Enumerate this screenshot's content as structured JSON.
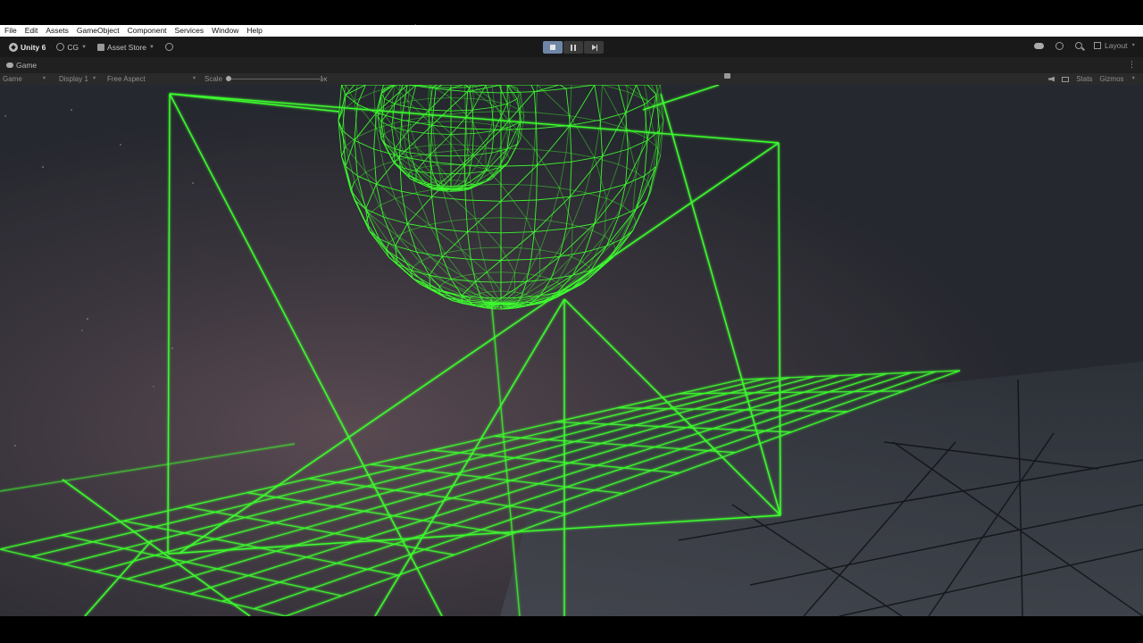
{
  "menubar": {
    "items": [
      "File",
      "Edit",
      "Assets",
      "GameObject",
      "Component",
      "Services",
      "Window",
      "Help"
    ]
  },
  "toolbar": {
    "unity_label": "Unity 6",
    "account_label": "CG",
    "asset_store_label": "Asset Store",
    "layout_label": "Layout",
    "play_state": "playing"
  },
  "tab": {
    "label": "Game"
  },
  "game_toolbar": {
    "mode_label": "Game",
    "display_label": "Display 1",
    "aspect_label": "Free Aspect",
    "scale_label": "Scale",
    "scale_value": "1x",
    "stats_label": "Stats",
    "gizmos_label": "Gizmos"
  },
  "colors": {
    "wireframe": "#3dff2e",
    "toolbar_bg": "#191919",
    "menubar_bg": "#ffffff",
    "play_active": "#6f86a8",
    "sky_dark": "#262830",
    "ground_dark": "#35393f"
  },
  "icons": {
    "unity": "unity-logo-icon",
    "account": "account-icon",
    "asset_store": "asset-store-icon",
    "cloud": "cloud-icon",
    "history": "history-icon",
    "search": "search-icon",
    "layout": "layout-icon"
  }
}
